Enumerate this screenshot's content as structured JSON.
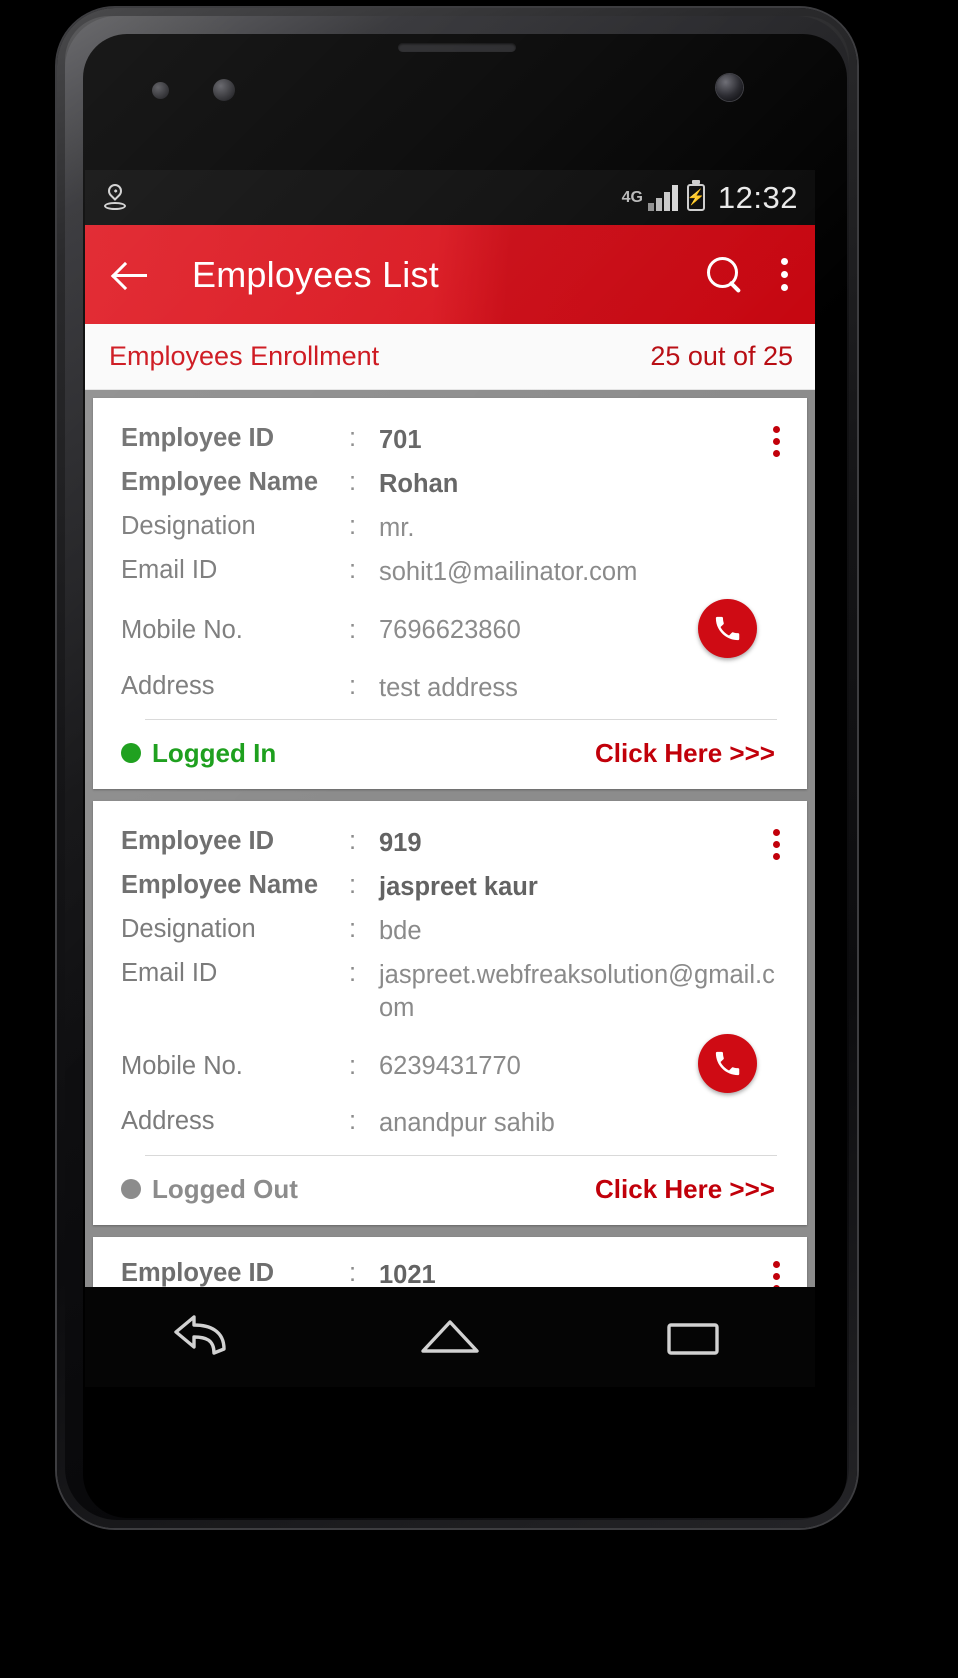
{
  "status_bar": {
    "gps_icon": "location-pin-icon",
    "network_type": "4G",
    "battery_icon": "battery-charging-icon",
    "time": "12:32"
  },
  "app_bar": {
    "back_icon": "back-arrow-icon",
    "title": "Employees List",
    "search_icon": "search-icon",
    "overflow_icon": "more-vertical-icon",
    "background_color": "#d9151e"
  },
  "sub_header": {
    "label": "Employees Enrollment",
    "count": "25 out of 25",
    "text_color": "#c00"
  },
  "labels": {
    "employee_id": "Employee ID",
    "employee_name": "Employee Name",
    "designation": "Designation",
    "email_id": "Email ID",
    "mobile_no": "Mobile No.",
    "address": "Address",
    "separator": ":",
    "click_here": "Click Here >>>"
  },
  "employees": [
    {
      "id": "701",
      "name": "Rohan",
      "designation": "mr.",
      "email": "sohit1@mailinator.com",
      "mobile": "7696623860",
      "address": "test address",
      "status": "Logged In",
      "status_color": "#1a9e1a",
      "call_icon": "phone-call-icon",
      "overflow_icon": "more-vertical-icon",
      "action": "Click Here >>>"
    },
    {
      "id": "919",
      "name": "jaspreet kaur",
      "designation": "bde",
      "email": "jaspreet.webfreaksolution@gmail.com",
      "mobile": "6239431770",
      "address": "anandpur sahib",
      "status": "Logged Out",
      "status_color": "#8c8c8c",
      "call_icon": "phone-call-icon",
      "overflow_icon": "more-vertical-icon",
      "action": "Click Here >>>"
    },
    {
      "id": "1021",
      "name": "",
      "designation": "",
      "email": "",
      "mobile": "",
      "address": "",
      "status": "",
      "status_color": "#8c8c8c",
      "call_icon": "phone-call-icon",
      "overflow_icon": "more-vertical-icon",
      "action": ""
    }
  ],
  "nav_bar": {
    "back": "nav-back-icon",
    "home": "nav-home-icon",
    "recents": "nav-recents-icon"
  }
}
